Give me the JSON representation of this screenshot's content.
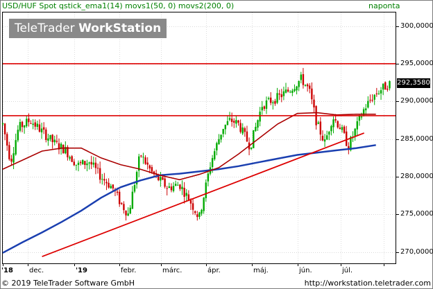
{
  "header": {
    "title": "USD/HUF Spot qstick_ema1(14) movs1(50, 0) movs2(200, 0)",
    "period": "naponta"
  },
  "watermark": {
    "brand": "TeleTrader",
    "product": "WorkStation"
  },
  "footer": {
    "copyright": "© 2019 TeleTrader Software GmbH",
    "url": "http://workstation.teletrader.com"
  },
  "colors": {
    "candle_up": "#00aa00",
    "candle_down": "#cc0000",
    "ma50": "#aa0000",
    "ma200": "#1a3fb0",
    "lines": "#dd0000",
    "header_text": "#008000"
  },
  "last_price": "292,3580",
  "chart_data": {
    "type": "candlestick",
    "x_tick_labels": [
      {
        "text": "'18",
        "bold": true
      },
      {
        "text": "dec.",
        "bold": false
      },
      {
        "text": "'19",
        "bold": true
      },
      {
        "text": "febr.",
        "bold": false
      },
      {
        "text": "márc.",
        "bold": false
      },
      {
        "text": "ápr.",
        "bold": false
      },
      {
        "text": "máj.",
        "bold": false
      },
      {
        "text": "jún.",
        "bold": false
      },
      {
        "text": "júl.",
        "bold": false
      }
    ],
    "y_tick_labels": [
      "300,0000",
      "295,0000",
      "290,0000",
      "285,0000",
      "280,0000",
      "275,0000",
      "270,0000"
    ],
    "y_ticks": [
      300,
      295,
      290,
      285,
      280,
      275,
      270
    ],
    "ylim": [
      268.5,
      301.8
    ],
    "horizontal_levels": [
      295.0,
      288.1
    ],
    "trendline": [
      [
        0.1,
        269.4
      ],
      [
        0.92,
        285.8
      ]
    ],
    "ma50": [
      [
        0.0,
        281.0
      ],
      [
        0.05,
        282.2
      ],
      [
        0.1,
        283.4
      ],
      [
        0.15,
        283.8
      ],
      [
        0.2,
        283.8
      ],
      [
        0.25,
        282.5
      ],
      [
        0.3,
        281.6
      ],
      [
        0.35,
        281.0
      ],
      [
        0.4,
        280.2
      ],
      [
        0.45,
        279.6
      ],
      [
        0.5,
        280.3
      ],
      [
        0.55,
        281.2
      ],
      [
        0.6,
        283.0
      ],
      [
        0.65,
        285.0
      ],
      [
        0.7,
        287.0
      ],
      [
        0.75,
        288.4
      ],
      [
        0.8,
        288.5
      ],
      [
        0.85,
        288.2
      ],
      [
        0.9,
        288.3
      ],
      [
        0.95,
        288.3
      ]
    ],
    "ma200": [
      [
        0.0,
        269.9
      ],
      [
        0.05,
        271.3
      ],
      [
        0.1,
        272.6
      ],
      [
        0.15,
        274.0
      ],
      [
        0.2,
        275.5
      ],
      [
        0.25,
        277.2
      ],
      [
        0.3,
        278.6
      ],
      [
        0.35,
        279.5
      ],
      [
        0.4,
        280.2
      ],
      [
        0.45,
        280.4
      ],
      [
        0.5,
        280.7
      ],
      [
        0.55,
        281.0
      ],
      [
        0.6,
        281.4
      ],
      [
        0.65,
        281.9
      ],
      [
        0.7,
        282.4
      ],
      [
        0.75,
        282.9
      ],
      [
        0.8,
        283.2
      ],
      [
        0.85,
        283.5
      ],
      [
        0.9,
        283.8
      ],
      [
        0.95,
        284.2
      ]
    ],
    "price_path": [
      [
        0.0,
        287.0
      ],
      [
        0.02,
        282.0
      ],
      [
        0.04,
        286.5
      ],
      [
        0.07,
        287.5
      ],
      [
        0.1,
        286.0
      ],
      [
        0.13,
        284.5
      ],
      [
        0.16,
        283.5
      ],
      [
        0.19,
        281.5
      ],
      [
        0.22,
        282.0
      ],
      [
        0.25,
        280.0
      ],
      [
        0.28,
        278.5
      ],
      [
        0.3,
        276.5
      ],
      [
        0.32,
        275.0
      ],
      [
        0.35,
        283.0
      ],
      [
        0.38,
        280.5
      ],
      [
        0.42,
        278.5
      ],
      [
        0.45,
        279.0
      ],
      [
        0.48,
        276.5
      ],
      [
        0.5,
        274.5
      ],
      [
        0.53,
        282.0
      ],
      [
        0.56,
        286.5
      ],
      [
        0.58,
        287.5
      ],
      [
        0.6,
        287.0
      ],
      [
        0.63,
        284.0
      ],
      [
        0.66,
        289.5
      ],
      [
        0.7,
        290.5
      ],
      [
        0.73,
        291.5
      ],
      [
        0.76,
        293.0
      ],
      [
        0.78,
        291.5
      ],
      [
        0.8,
        287.0
      ],
      [
        0.82,
        284.5
      ],
      [
        0.84,
        288.0
      ],
      [
        0.86,
        286.5
      ],
      [
        0.88,
        284.0
      ],
      [
        0.9,
        286.5
      ],
      [
        0.92,
        289.0
      ],
      [
        0.94,
        290.5
      ],
      [
        0.96,
        291.5
      ],
      [
        0.985,
        292.36
      ]
    ]
  }
}
